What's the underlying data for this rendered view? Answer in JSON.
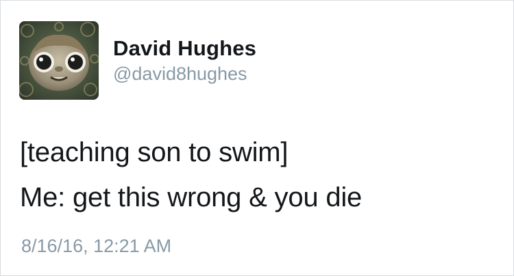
{
  "tweet": {
    "author_name": "David Hughes",
    "author_handle": "@david8hughes",
    "text_lines": [
      "[teaching son to swim]",
      "Me: get this wrong & you die"
    ],
    "timestamp": "8/16/16, 12:21 AM"
  },
  "colors": {
    "name": "#14171a",
    "secondary_text": "#8899a6",
    "border": "#d8dce0"
  }
}
